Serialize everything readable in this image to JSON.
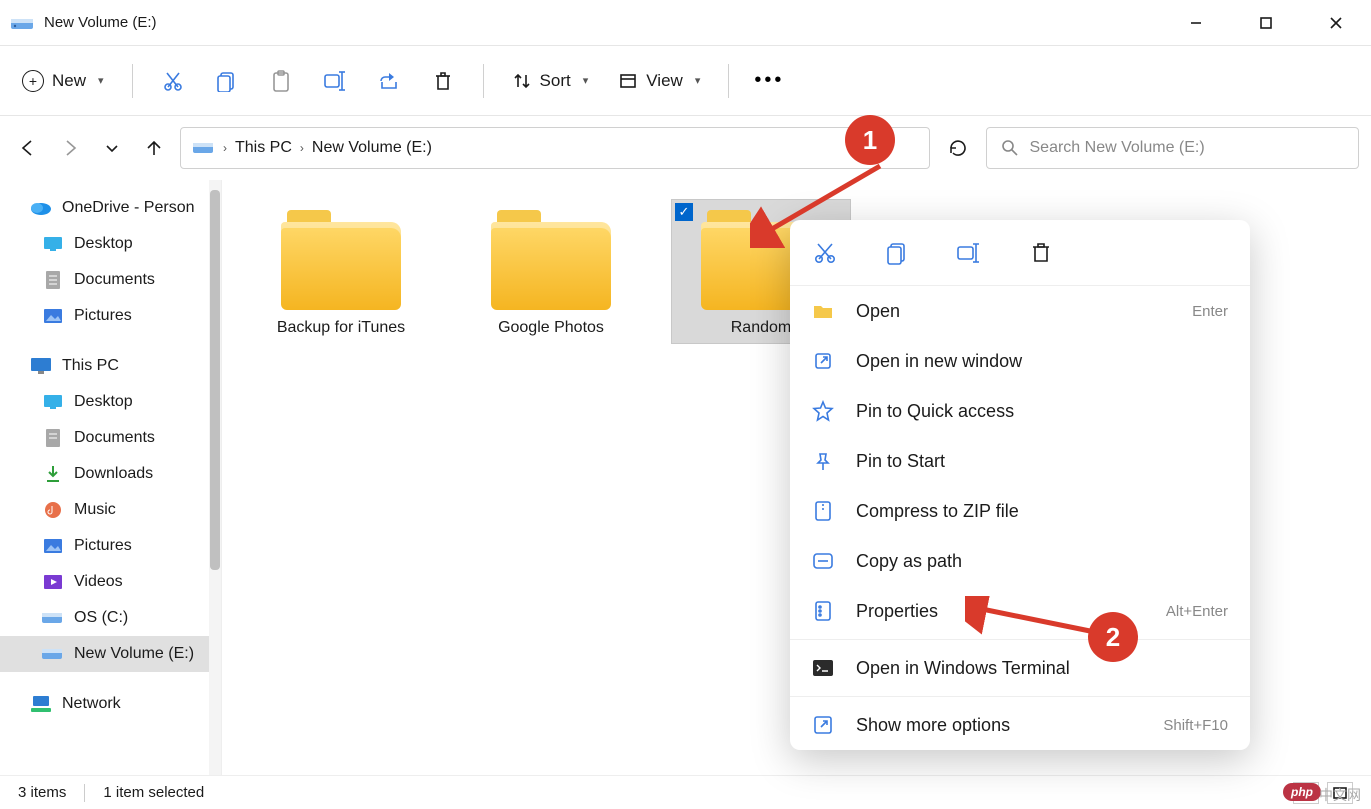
{
  "title": "New Volume (E:)",
  "window_controls": {
    "min": "minimize",
    "max": "maximize",
    "close": "close"
  },
  "toolbar": {
    "new": "New",
    "sort": "Sort",
    "view": "View",
    "icons": {
      "cut": "cut-icon",
      "copy": "copy-icon",
      "paste": "paste-icon",
      "rename": "rename-icon",
      "share": "share-icon",
      "delete": "delete-icon",
      "more": "more-icon"
    }
  },
  "nav": {
    "back": "back",
    "forward": "forward",
    "recent": "recent",
    "up": "up"
  },
  "address": {
    "segments": [
      "This PC",
      "New Volume (E:)"
    ]
  },
  "refresh": "refresh",
  "search": {
    "placeholder": "Search New Volume (E:)"
  },
  "sidebar": {
    "onedrive": "OneDrive - Person",
    "od_items": [
      "Desktop",
      "Documents",
      "Pictures"
    ],
    "thispc": "This PC",
    "pc_items": [
      "Desktop",
      "Documents",
      "Downloads",
      "Music",
      "Pictures",
      "Videos",
      "OS (C:)",
      "New Volume (E:)"
    ],
    "network": "Network"
  },
  "folders": [
    {
      "name": "Backup for iTunes",
      "selected": false
    },
    {
      "name": "Google Photos",
      "selected": false
    },
    {
      "name": "Random",
      "selected": true
    }
  ],
  "context_menu": {
    "icon_row": [
      "cut",
      "copy",
      "rename",
      "delete"
    ],
    "items": [
      {
        "icon": "open",
        "label": "Open",
        "hint": "Enter"
      },
      {
        "icon": "openwin",
        "label": "Open in new window",
        "hint": ""
      },
      {
        "icon": "pinquick",
        "label": "Pin to Quick access",
        "hint": ""
      },
      {
        "icon": "pinstart",
        "label": "Pin to Start",
        "hint": ""
      },
      {
        "icon": "zip",
        "label": "Compress to ZIP file",
        "hint": ""
      },
      {
        "icon": "copypath",
        "label": "Copy as path",
        "hint": ""
      },
      {
        "icon": "properties",
        "label": "Properties",
        "hint": "Alt+Enter"
      }
    ],
    "items2": [
      {
        "icon": "terminal",
        "label": "Open in Windows Terminal",
        "hint": ""
      }
    ],
    "items3": [
      {
        "icon": "more",
        "label": "Show more options",
        "hint": "Shift+F10"
      }
    ]
  },
  "status": {
    "items": "3 items",
    "selected": "1 item selected"
  },
  "annotations": {
    "b1": "1",
    "b2": "2"
  },
  "watermark": {
    "text": "中文网",
    "php": "php"
  }
}
